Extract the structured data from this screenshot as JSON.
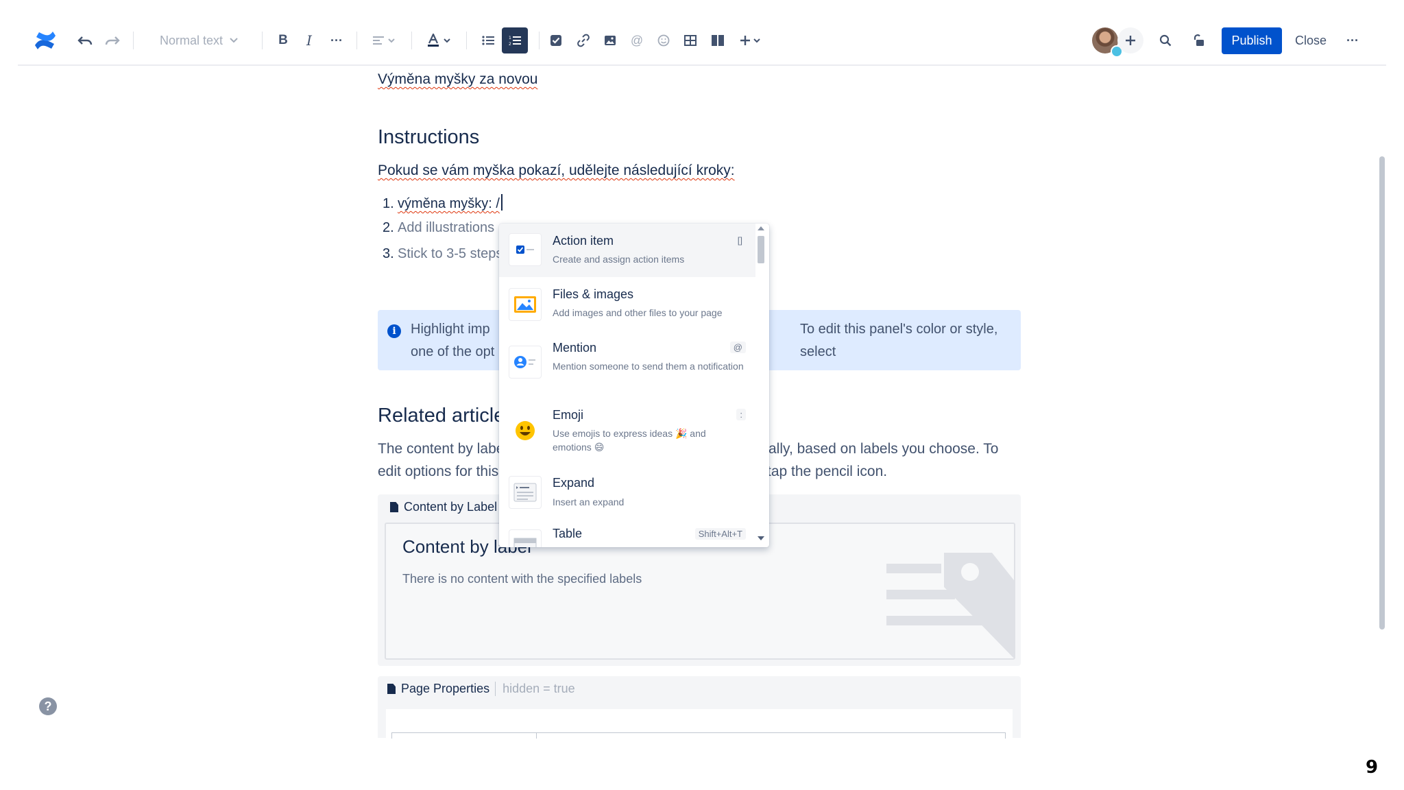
{
  "toolbar": {
    "text_style": "Normal text",
    "publish_label": "Publish",
    "close_label": "Close"
  },
  "colors": {
    "accent": "#0052cc",
    "info_panel": "#deebff",
    "text": "#172b4d"
  },
  "content": {
    "page_title": "Výměna myšky za novou",
    "instructions_heading": "Instructions",
    "intro": "Pokud se vám myška pokazí, udělejte následující kroky:",
    "steps": [
      {
        "num": "1.",
        "text": "výměna myšky: /"
      },
      {
        "num": "2.",
        "text": "Add illustrations"
      },
      {
        "num": "3.",
        "text": "Stick to 3-5 steps"
      }
    ],
    "info_panel": {
      "line1_left": "Highlight imp",
      "line1_right": "To edit this panel's color or style, select",
      "line2_left": "one of the opt"
    },
    "related_heading": "Related article",
    "related_text": {
      "line1_left": "The content by labe",
      "line1_right": "ally, based on labels you choose. To",
      "line2_left": "edit options for this",
      "line2_right": "tap the pencil icon."
    },
    "content_by_label": {
      "header": "Content by Label",
      "title": "Content by label",
      "empty_message": "There is no content with the specified labels"
    },
    "page_properties": {
      "header": "Page Properties",
      "hidden": "hidden = true"
    }
  },
  "insert_menu": {
    "items": [
      {
        "title": "Action item",
        "desc": "Create and assign action items",
        "shortcut": "[]",
        "icon": "checkbox-icon"
      },
      {
        "title": "Files & images",
        "desc": "Add images and other files to your page",
        "shortcut": "",
        "icon": "image-icon"
      },
      {
        "title": "Mention",
        "desc": "Mention someone to send them a notification",
        "shortcut": "@",
        "icon": "mention-icon"
      },
      {
        "title": "Emoji",
        "desc": "Use emojis to express ideas 🎉 and emotions 😄",
        "shortcut": ":",
        "icon": "emoji-icon"
      },
      {
        "title": "Expand",
        "desc": "Insert an expand",
        "shortcut": "",
        "icon": "expand-icon"
      },
      {
        "title": "Table",
        "desc": "",
        "shortcut": "Shift+Alt+T",
        "icon": "table-icon"
      }
    ]
  },
  "help_label": "?",
  "slide_number": "9"
}
